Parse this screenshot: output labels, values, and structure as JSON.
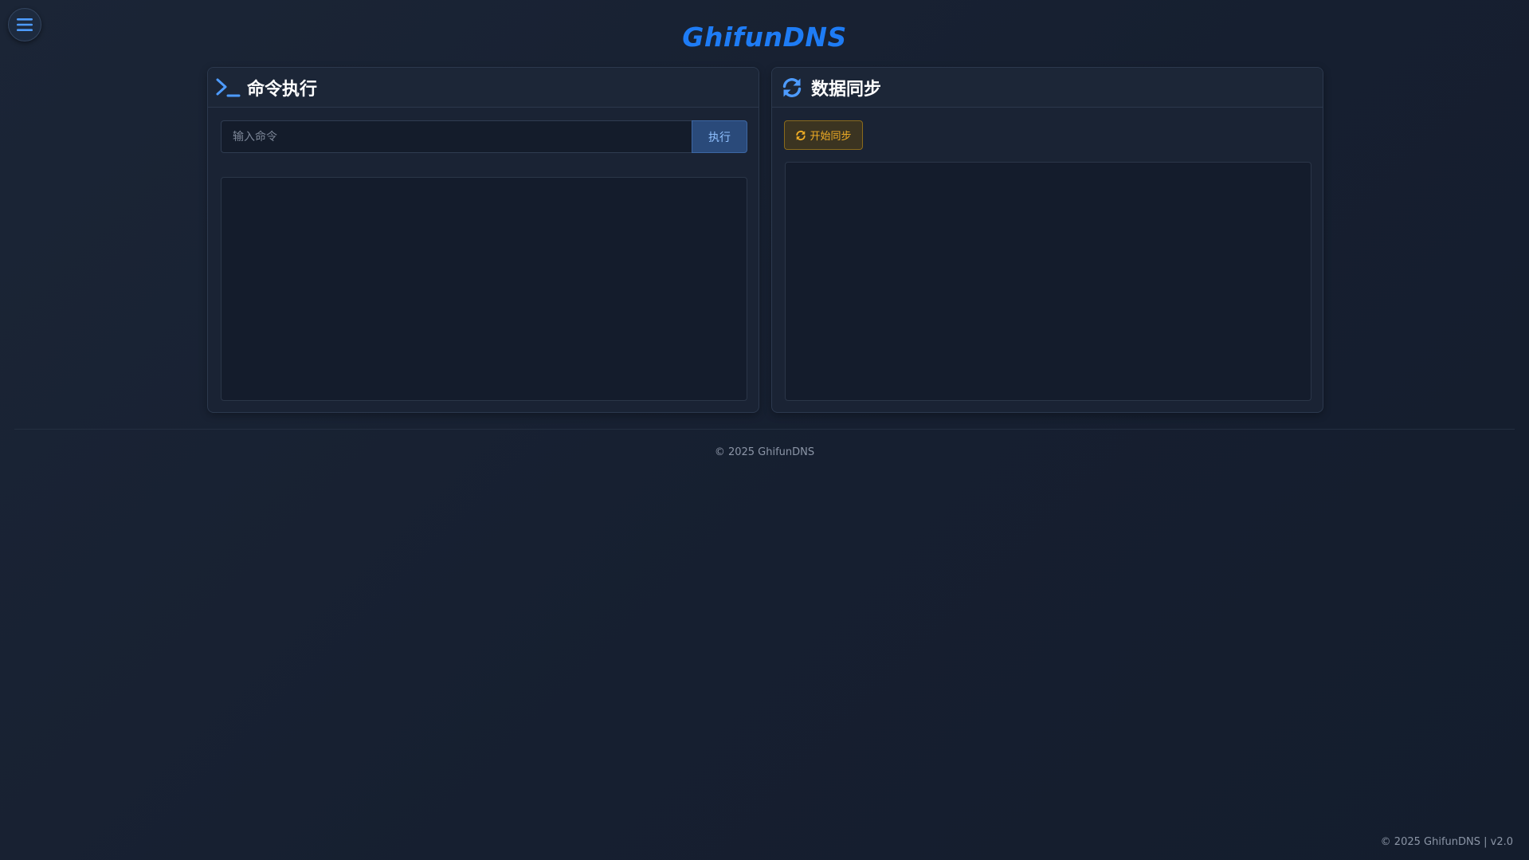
{
  "menu": {
    "icon": "hamburger-menu-icon"
  },
  "brand": {
    "title": "GhifunDNS"
  },
  "command_panel": {
    "icon": "terminal-prompt-icon",
    "title": "命令执行",
    "input_placeholder": "输入命令",
    "input_value": "",
    "execute_label": "执行",
    "output": ""
  },
  "sync_panel": {
    "icon": "sync-refresh-icon",
    "title": "数据同步",
    "button_icon": "sync-refresh-icon",
    "button_label": "开始同步",
    "output": ""
  },
  "footer": {
    "center": "© 2025 GhifunDNS",
    "right": "© 2025 GhifunDNS | v2.0"
  },
  "colors": {
    "accent": "#1e7cf5",
    "sync_button": "#f0ad25",
    "background": "#192233"
  }
}
